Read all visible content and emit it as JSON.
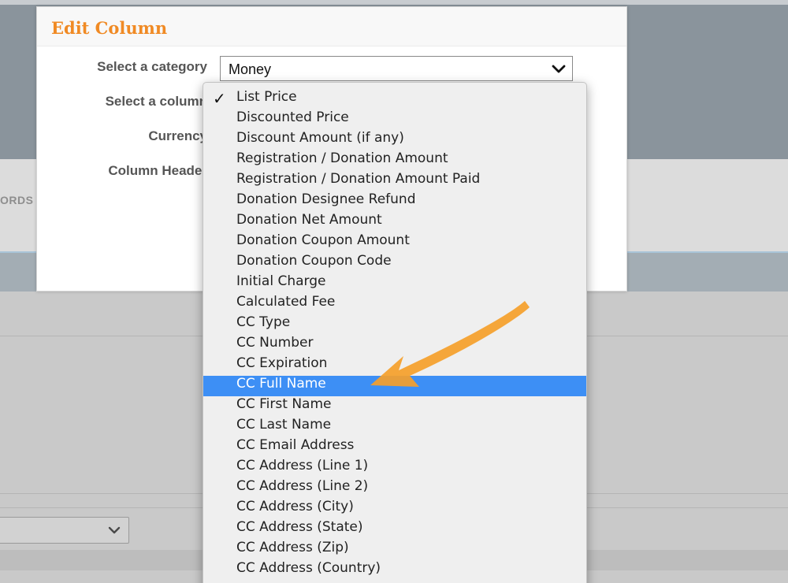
{
  "background": {
    "tab_fragment": "ORDS"
  },
  "modal": {
    "title": "Edit Column",
    "labels": {
      "category": "Select a category",
      "column": "Select a column",
      "currency": "Currency",
      "column_header": "Column Header"
    },
    "category_select": {
      "value": "Money"
    }
  },
  "dropdown": {
    "checked_index": 0,
    "selected_index": 14,
    "options": [
      "List Price",
      "Discounted Price",
      "Discount Amount (if any)",
      "Registration / Donation Amount",
      "Registration / Donation Amount Paid",
      "Donation Designee Refund",
      "Donation Net Amount",
      "Donation Coupon Amount",
      "Donation Coupon Code",
      "Initial Charge",
      "Calculated Fee",
      "CC Type",
      "CC Number",
      "CC Expiration",
      "CC Full Name",
      "CC First Name",
      "CC Last Name",
      "CC Email Address",
      "CC Address (Line 1)",
      "CC Address (Line 2)",
      "CC Address (City)",
      "CC Address (State)",
      "CC Address (Zip)",
      "CC Address (Country)"
    ]
  },
  "colors": {
    "title_orange": "#f08a24",
    "selection_blue": "#3d8ff5",
    "arrow_orange": "#f5a02a"
  },
  "icons": {
    "check": "✓",
    "chevron": "chevron-down-icon"
  }
}
